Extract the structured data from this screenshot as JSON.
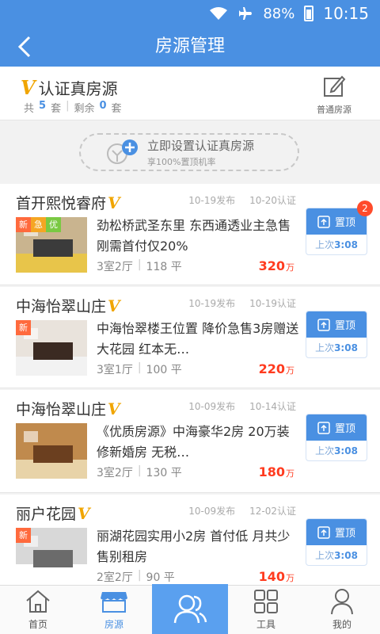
{
  "status_bar": {
    "battery": "88%",
    "time": "10:15"
  },
  "nav": {
    "title": "房源管理"
  },
  "verified": {
    "mark": "V",
    "title": "认证真房源",
    "total_label": "共",
    "total": "5",
    "total_unit": "套",
    "remain_label": "剩余",
    "remain": "0",
    "remain_unit": "套",
    "normal_label": "普通房源"
  },
  "setup": {
    "line1": "立即设置认证真房源",
    "line2": "享100%置顶机率"
  },
  "listings": [
    {
      "name": "首开熙悦睿府",
      "published": "10-19发布",
      "verified": "10-20认证",
      "tags": [
        "新",
        "急",
        "优"
      ],
      "desc": "劲松桥武圣东里 东西通透业主急售刚需首付仅20%",
      "layout": "3室2厅",
      "area": "118 平",
      "price": "320",
      "price_unit": "万",
      "top_label": "置顶",
      "last_label": "上次",
      "last_time": "3:08",
      "badge": "2"
    },
    {
      "name": "中海怡翠山庄",
      "published": "10-19发布",
      "verified": "10-19认证",
      "tags": [
        "新"
      ],
      "desc": "中海怡翠楼王位置 降价急售3房赠送大花园 红本无…",
      "layout": "3室1厅",
      "area": "100 平",
      "price": "220",
      "price_unit": "万",
      "top_label": "置顶",
      "last_label": "上次",
      "last_time": "3:08"
    },
    {
      "name": "中海怡翠山庄",
      "published": "10-09发布",
      "verified": "10-14认证",
      "tags": [],
      "desc": "《优质房源》中海豪华2房 20万装修新婚房 无税…",
      "layout": "3室2厅",
      "area": "130 平",
      "price": "180",
      "price_unit": "万",
      "top_label": "置顶",
      "last_label": "上次",
      "last_time": "3:08"
    },
    {
      "name": "丽户花园",
      "published": "10-09发布",
      "verified": "12-02认证",
      "tags": [
        "新"
      ],
      "desc": "丽湖花园实用小2房 首付低 月共少售别租房",
      "layout": "2室2厅",
      "area": "90 平",
      "price": "140",
      "price_unit": "万",
      "top_label": "置顶",
      "last_label": "上次",
      "last_time": "3:08"
    }
  ],
  "colors": {
    "accent": "#4a90e2",
    "price": "#ff3b1f",
    "tag_new": "#ff6a3d",
    "tag_urgent": "#f5a623",
    "tag_good": "#7ac943"
  },
  "tabs": [
    {
      "label": "首页",
      "icon": "home-icon"
    },
    {
      "label": "房源",
      "icon": "store-icon"
    },
    {
      "label": "",
      "icon": "customers-icon"
    },
    {
      "label": "工具",
      "icon": "grid-icon"
    },
    {
      "label": "我的",
      "icon": "person-icon"
    }
  ]
}
